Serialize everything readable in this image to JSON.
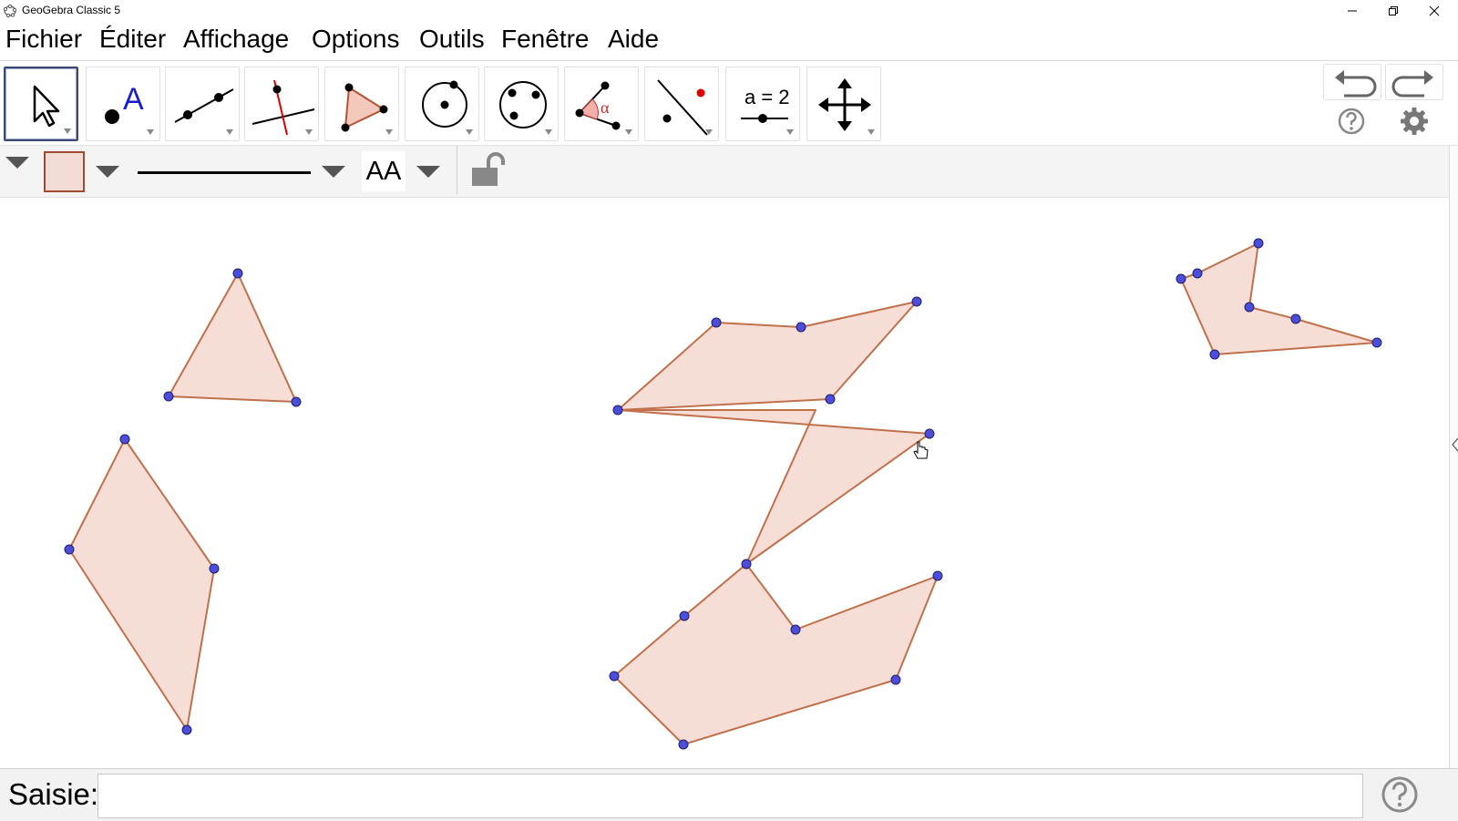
{
  "window": {
    "title": "GeoGebra Classic 5"
  },
  "menu": [
    "Fichier",
    "Éditer",
    "Affichage",
    "Options",
    "Outils",
    "Fenêtre",
    "Aide"
  ],
  "toolbar": {
    "tools": [
      {
        "name": "move-tool",
        "icon": "arrow-pointer-icon",
        "active": true
      },
      {
        "name": "point-tool",
        "icon": "point-A-icon",
        "glyph": "A"
      },
      {
        "name": "line-tool",
        "icon": "line-through-points-icon"
      },
      {
        "name": "perpendicular-line-tool",
        "icon": "perpendicular-line-icon"
      },
      {
        "name": "polygon-tool",
        "icon": "polygon-icon"
      },
      {
        "name": "circle-center-point-tool",
        "icon": "circle-center-icon"
      },
      {
        "name": "circle-three-points-tool",
        "icon": "circle-three-points-icon"
      },
      {
        "name": "angle-tool",
        "icon": "angle-icon",
        "glyph": "α"
      },
      {
        "name": "reflect-tool",
        "icon": "reflect-about-line-icon"
      },
      {
        "name": "slider-tool",
        "icon": "slider-icon",
        "glyph": "a = 2"
      },
      {
        "name": "move-graphics-view-tool",
        "icon": "move-arrows-icon"
      }
    ]
  },
  "colors": {
    "fill": "#f6ded7",
    "stroke": "#c0704b",
    "point": "#4d4ddb",
    "pointStroke": "#1f1f66",
    "styleColorSwatch": "#f3dcd6"
  },
  "stylebar": {
    "font_label": "AA"
  },
  "inputbar": {
    "label": "Saisie:",
    "value": ""
  }
}
